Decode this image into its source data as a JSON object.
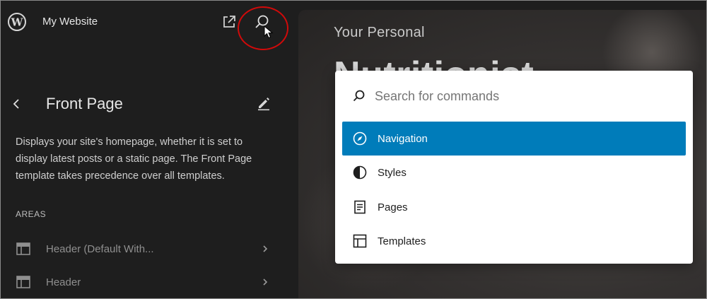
{
  "sidebar": {
    "site_name": "My Website",
    "page_title": "Front Page",
    "description": "Displays your site's homepage, whether it is set to display latest posts or a static page. The Front Page template takes precedence over all templates.",
    "areas_heading": "AREAS",
    "areas": [
      {
        "label": "Header (Default With..."
      },
      {
        "label": "Header"
      }
    ]
  },
  "preview": {
    "hero_subtitle": "Your Personal",
    "hero_title": "Nutritionist"
  },
  "command_palette": {
    "search_placeholder": "Search for commands",
    "search_value": "",
    "commands": [
      {
        "label": "Navigation",
        "icon": "compass-icon",
        "active": true
      },
      {
        "label": "Styles",
        "icon": "half-circle-icon",
        "active": false
      },
      {
        "label": "Pages",
        "icon": "page-icon",
        "active": false
      },
      {
        "label": "Templates",
        "icon": "layout-icon",
        "active": false
      }
    ]
  },
  "colors": {
    "sidebar_bg": "#1e1e1e",
    "accent": "#007cba",
    "annotation": "#d10a0a"
  }
}
